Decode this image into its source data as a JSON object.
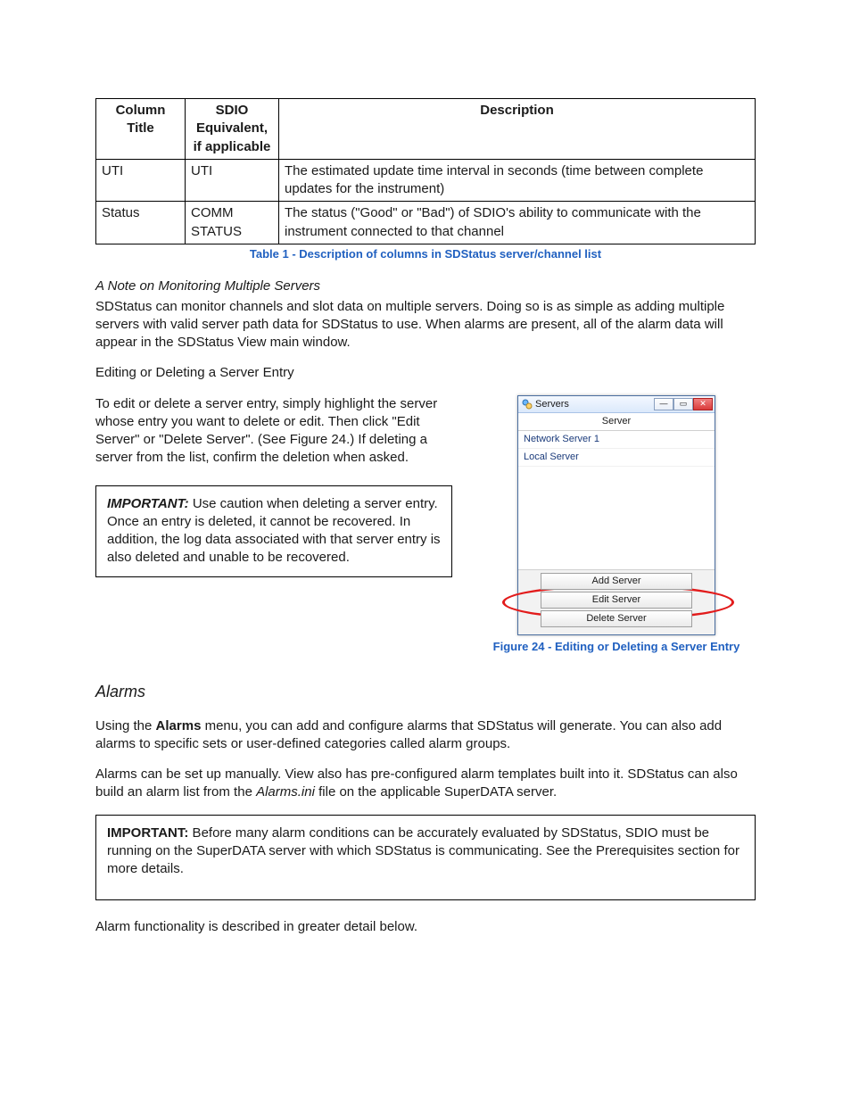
{
  "table": {
    "headers": [
      "Column Title",
      "SDIO Equivalent, if applicable",
      "Description"
    ],
    "rows": [
      {
        "c1": "UTI",
        "c2": "UTI",
        "c3": "The estimated update time interval in seconds (time between complete updates for the instrument)"
      },
      {
        "c1": "Status",
        "c2": "COMM STATUS",
        "c3": "The status (\"Good\" or \"Bad\") of SDIO's ability to communicate with the instrument connected to that channel"
      }
    ],
    "caption": "Table 1 - Description of columns in SDStatus server/channel list"
  },
  "note": {
    "heading": "A Note on Monitoring Multiple Servers",
    "body": "SDStatus can monitor channels and slot data on multiple servers. Doing so is as simple as adding multiple servers with valid server path data for SDStatus to use. When alarms are present, all of the alarm data will appear in the SDStatus View main window."
  },
  "editing": {
    "heading": "Editing or Deleting a Server Entry",
    "body": "To edit or delete a server entry, simply highlight the server whose entry you want to delete or edit. Then click \"Edit Server\" or \"Delete Server\". (See Figure 24.) If deleting a server from the list, confirm the deletion when asked."
  },
  "important1": {
    "label": "IMPORTANT:",
    "body": " Use caution when deleting a server entry. Once an entry is deleted, it cannot be recovered. In addition, the log data associated with that server entry is also deleted and unable to be recovered."
  },
  "dialog": {
    "title": "Servers",
    "column": "Server",
    "rows": [
      "Network Server 1",
      "Local Server"
    ],
    "buttons": {
      "add": "Add Server",
      "edit": "Edit Server",
      "delete": "Delete Server"
    },
    "caption": "Figure 24 - Editing or Deleting a Server Entry"
  },
  "alarms": {
    "heading": "Alarms",
    "p1a": "Using the ",
    "p1b": "Alarms",
    "p1c": " menu, you can add and configure alarms that SDStatus will generate. You can also add alarms to specific sets or user-defined categories called alarm groups.",
    "p2a": "Alarms can be set up manually. View also has pre-configured alarm templates built into it. SDStatus can also build an alarm list from the ",
    "p2b": "Alarms.ini",
    "p2c": "  file on the applicable SuperDATA server."
  },
  "important2": {
    "label": "IMPORTANT:",
    "body": "  Before many alarm conditions can be accurately evaluated by SDStatus, SDIO must be running on the SuperDATA server with which SDStatus is communicating. See the Prerequisites section for more details."
  },
  "closing": "Alarm functionality is described in greater detail below."
}
